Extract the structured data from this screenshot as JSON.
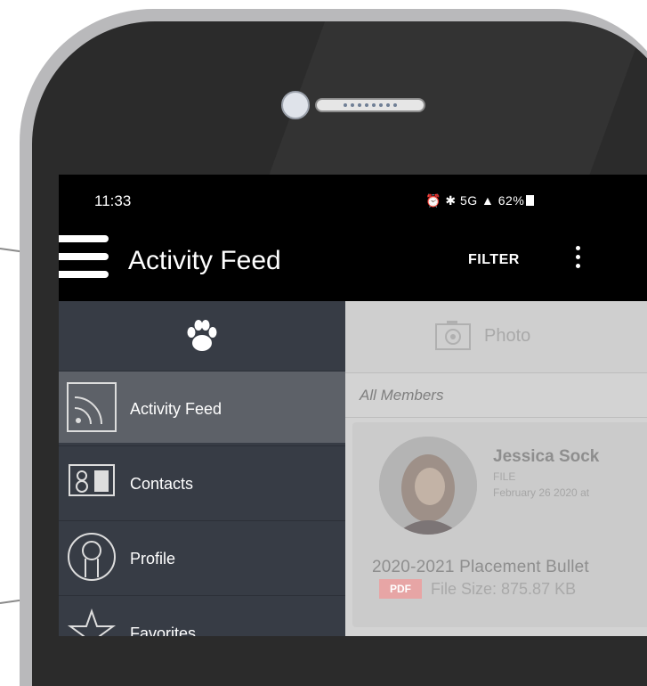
{
  "status_bar": {
    "time": "11:33",
    "icons_text": "⏰ ✱ 5G ▲",
    "battery": "62%"
  },
  "app_bar": {
    "title": "Activity Feed",
    "filter_label": "FILTER"
  },
  "drawer": {
    "logo": "paw-icon",
    "items": [
      {
        "label": "Activity Feed",
        "icon": "rss-icon",
        "active": true
      },
      {
        "label": "Contacts",
        "icon": "contact-card-icon",
        "active": false
      },
      {
        "label": "Profile",
        "icon": "person-icon",
        "active": false
      },
      {
        "label": "Favorites",
        "icon": "star-icon",
        "active": false
      }
    ]
  },
  "feed": {
    "photo_label": "Photo",
    "audience": "All Members",
    "post": {
      "author": "Jessica Sock",
      "type": "FILE",
      "date": "February 26 2020 at",
      "document_title": "2020-2021 Placement Bullet",
      "file_badge": "PDF",
      "file_size": "File Size: 875.87 KB"
    }
  },
  "colors": {
    "drawer_bg": "#373c45",
    "drawer_active": "#5d6168",
    "content_bg": "#d3d3d3",
    "pdf_badge": "#e7a5a5"
  }
}
